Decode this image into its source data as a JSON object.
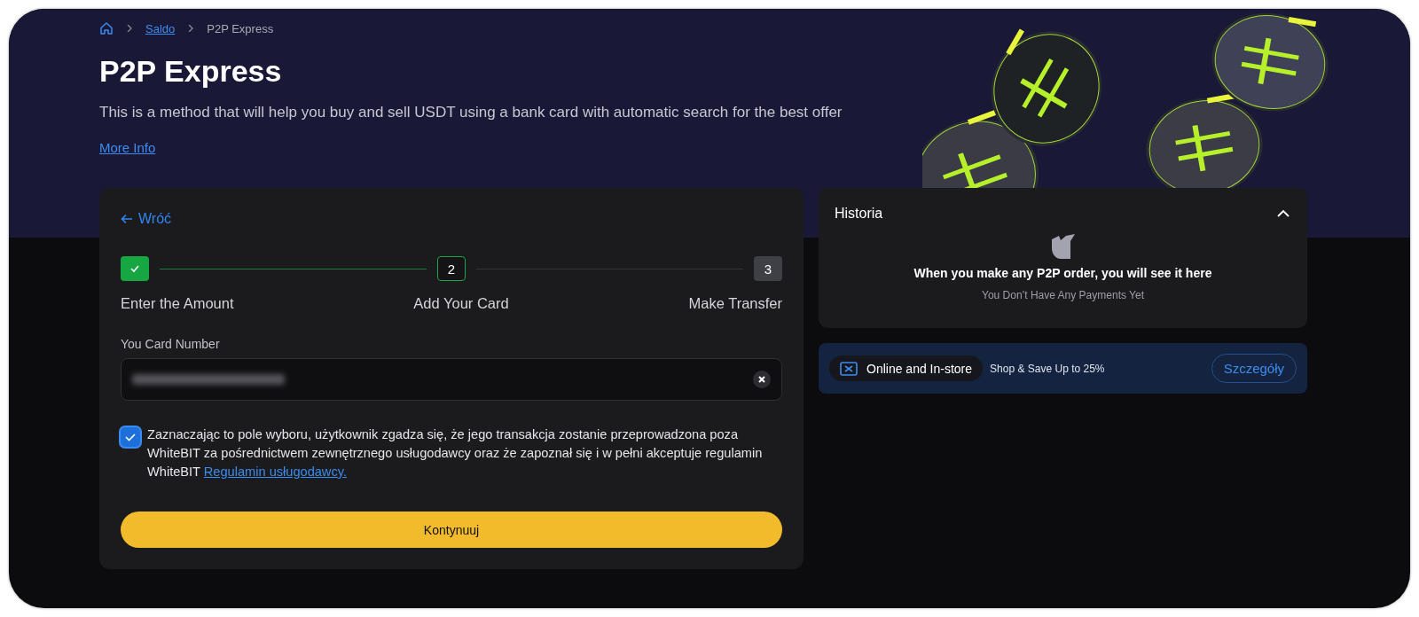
{
  "breadcrumb": [
    {
      "label": "Saldo",
      "kind": "link"
    },
    {
      "label": "P2P Express",
      "kind": "current"
    }
  ],
  "header": {
    "title": "P2P Express",
    "description": "This is a method that will help you buy and sell USDT using a bank card with automatic search for the best offer",
    "link": "More Info"
  },
  "form": {
    "back": "Wróć",
    "steps": [
      {
        "label": "Enter the Amount",
        "completed": true,
        "selected": false
      },
      {
        "number": "2",
        "label": "Add Your Card",
        "completed": false,
        "selected": true
      },
      {
        "number": "3",
        "label": "Make Transfer",
        "completed": false,
        "selected": false
      }
    ],
    "card_field": {
      "label": "You Card Number"
    },
    "consent": {
      "checked": true,
      "text": "Zaznaczając to pole wyboru, użytkownik zgadza się, że jego transakcja zostanie przeprowadzona poza WhiteBIT za pośrednictwem zewnętrznego usługodawcy oraz że zapoznał się i w pełni akceptuje regulamin WhiteBIT",
      "link": "Regulamin usługodawcy."
    },
    "submit": "Kontynuuj"
  },
  "history": {
    "title": "Historia",
    "expanded": true,
    "empty_title": "When you make any P2P order, you will see it here",
    "empty_subtitle": "You Don’t Have Any Payments Yet"
  },
  "promo": {
    "badge": "Online and In-store",
    "text": "Shop & Save Up to 25%",
    "button": "Szczegóły"
  }
}
